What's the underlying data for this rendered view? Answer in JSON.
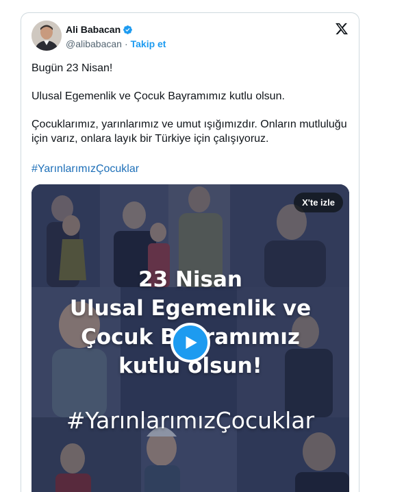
{
  "author": {
    "name": "Ali Babacan",
    "handle": "@alibabacan",
    "separator": "·",
    "follow_label": "Takip et"
  },
  "post": {
    "line1": "Bugün 23 Nisan!",
    "line2": "Ulusal Egemenlik ve Çocuk Bayramımız kutlu olsun.",
    "line3": "Çocuklarımız, yarınlarımız ve umut ışığımızdır. Onların mutluluğu için varız, onlara layık bir Türkiye için çalışıyoruz.",
    "hashtag": "#YarınlarımızÇocuklar"
  },
  "media": {
    "watch_on_x_label": "X'te izle",
    "overlay_lines": [
      "23 Nisan",
      "Ulusal Egemenlik ve",
      "Çocuk Bayramımız",
      "kutlu olsun!",
      "#YarınlarımızÇocuklar"
    ]
  },
  "icons": {
    "verified": "verified-badge-icon",
    "x_logo": "x-logo-icon",
    "play": "play-icon"
  },
  "colors": {
    "accent": "#1d9bf0",
    "hashtag": "#1d6fb8",
    "muted": "#536471",
    "video_tint": "#2a3350"
  }
}
